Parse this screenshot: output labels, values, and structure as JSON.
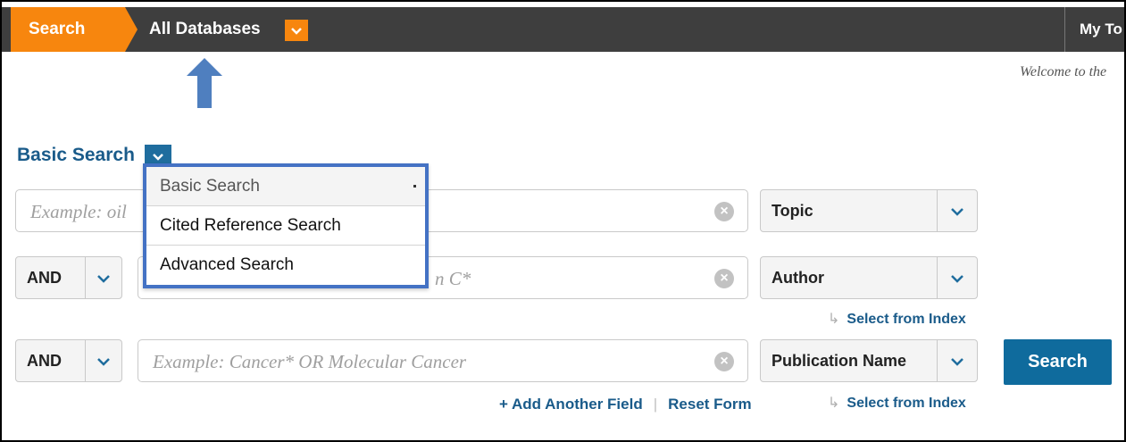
{
  "topbar": {
    "search_tab": "Search",
    "database": "All Databases",
    "my_tools": "My To"
  },
  "welcome": "Welcome to the",
  "basic_search": {
    "title": "Basic Search",
    "menu": [
      {
        "label": "Basic Search",
        "selected": true
      },
      {
        "label": "Cited Reference Search",
        "selected": false
      },
      {
        "label": "Advanced Search",
        "selected": false
      }
    ]
  },
  "rows": [
    {
      "operator": null,
      "placeholder": "Example: oil",
      "field": "Topic",
      "select_index": null
    },
    {
      "operator": "AND",
      "placeholder": "n C*",
      "field": "Author",
      "select_index": "Select from Index"
    },
    {
      "operator": "AND",
      "placeholder": "Example: Cancer* OR Molecular Cancer",
      "field": "Publication Name",
      "select_index": "Select from Index"
    }
  ],
  "search_button": "Search",
  "footer": {
    "add_field": "+ Add Another Field",
    "separator": "|",
    "reset": "Reset Form"
  },
  "colors": {
    "accent_orange": "#f7860e",
    "topbar": "#3e3e3e",
    "link_blue": "#1a5b8a",
    "button_blue": "#0f6b9d",
    "highlight_box": "#4472c4",
    "arrow": "#4f7fbf"
  },
  "icons": {
    "dropdown": "chevron-down-icon",
    "clear": "clear-icon",
    "arrow": "arrow-up-icon",
    "index": "return-arrow-icon"
  }
}
